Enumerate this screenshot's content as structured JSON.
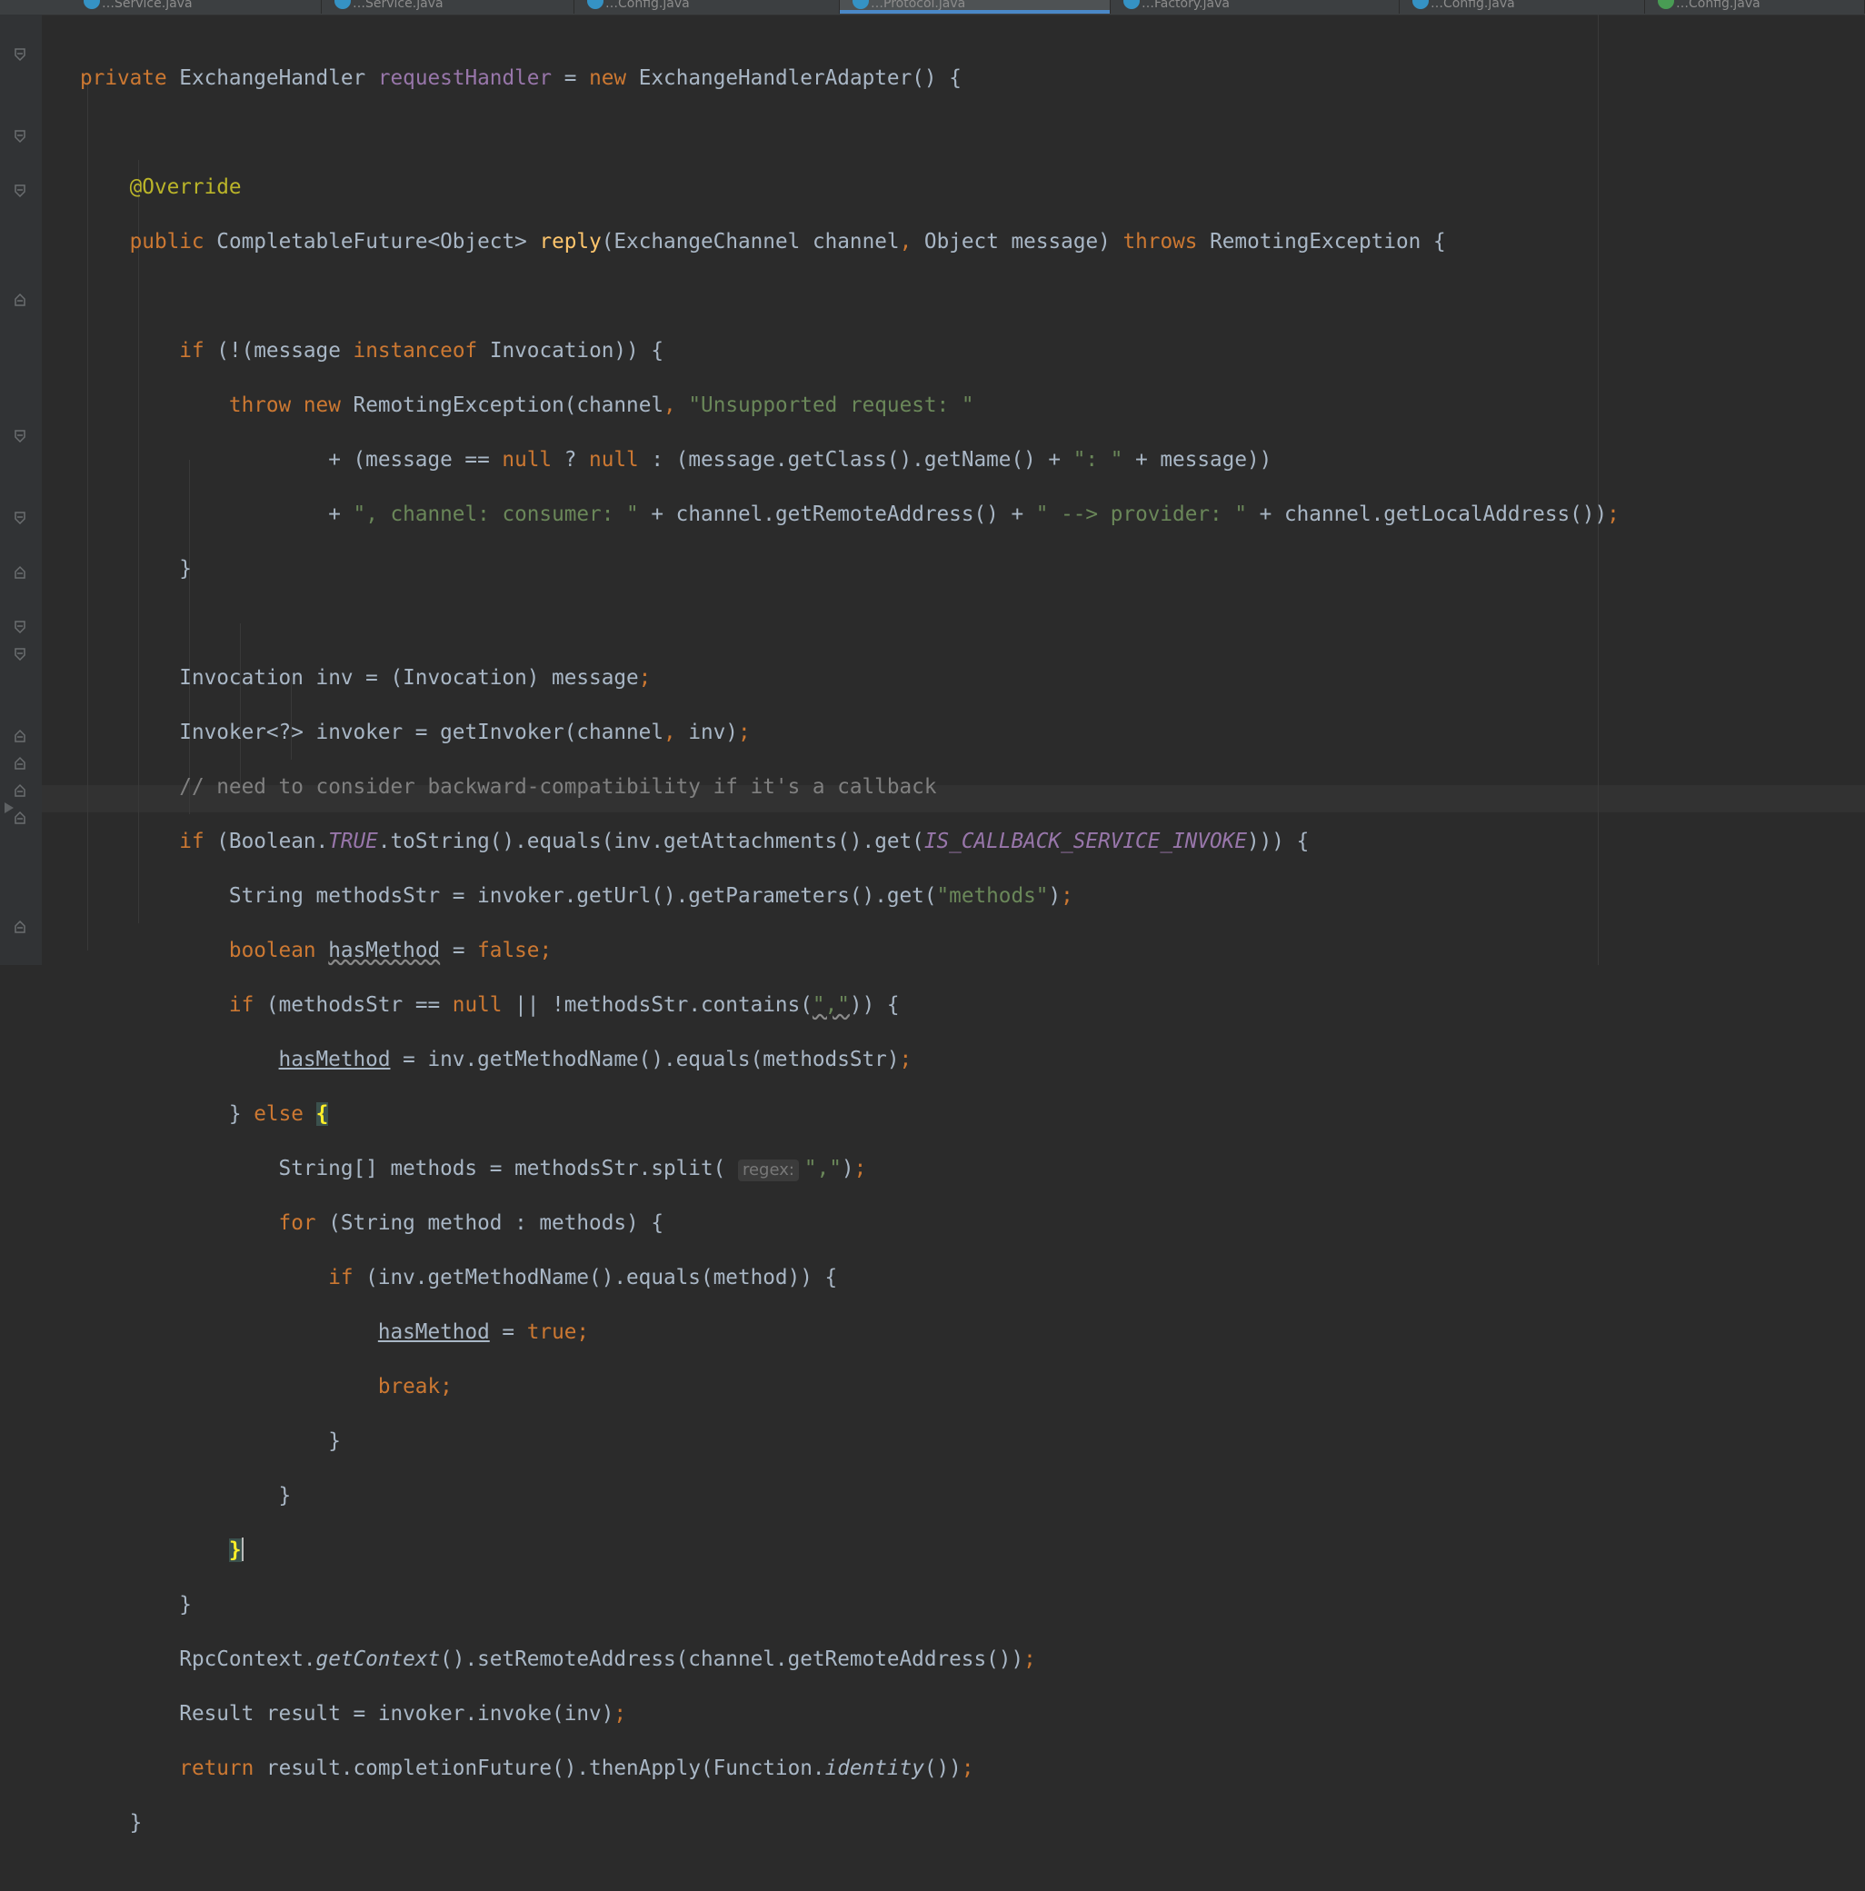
{
  "tabs": [
    {
      "label": "…Service.java",
      "active": false
    },
    {
      "label": "…Service.java",
      "active": false
    },
    {
      "label": "…Config.java",
      "active": false
    },
    {
      "label": "…Protocol.java",
      "active": true
    },
    {
      "label": "…Factory.java",
      "active": false
    },
    {
      "label": "…Config.java",
      "active": false
    },
    {
      "label": "…Config.java",
      "active": false
    }
  ],
  "editor": {
    "tokens": {
      "private": "private",
      "type_ExchangeHandler": "ExchangeHandler",
      "requestHandler": "requestHandler",
      "eq": " = ",
      "new": "new",
      "new_adapter": "ExchangeHandlerAdapter() {",
      "override": "@Override",
      "public": "public",
      "reply_ret": "CompletableFuture<Object>",
      "reply_name": "reply",
      "reply_params_1": "(ExchangeChannel channel",
      "comma": ",",
      "reply_params_2": "Object message)",
      "throws": "throws",
      "reply_exc": "RemotingException {",
      "if": "if",
      "instanceof": "instanceof",
      "l6_open": "(!(message",
      "l6_close": "Invocation)) {",
      "throw": "throw",
      "l7_ctor": "RemotingException(channel",
      "s_unsupported": "\"Unsupported request: \"",
      "l8_a": "+ (message == ",
      "null": "null",
      "l8_q": " ? ",
      "l8_b": " : (message.getClass().getName() + ",
      "s_colon": "\": \"",
      "l8_c": " + message))",
      "plus": "+",
      "s_channel_consumer": "\", channel: consumer: \"",
      "l9_a": " + channel.getRemoteAddress() + ",
      "s_provider": "\" --> provider: \"",
      "l9_b": " + channel.getLocalAddress())",
      "semi": ";",
      "rbrace": "}",
      "l12": "Invocation inv = (Invocation) message",
      "l13_a": "Invoker<?> invoker = getInvoker(channel",
      "l13_b": " inv)",
      "comment": "// need to consider backward-compatibility if it's a callback",
      "l15_a": " (Boolean.",
      "TRUE": "TRUE",
      "l15_b": ".toString().equals(inv.getAttachments().get(",
      "IS_CALLBACK": "IS_CALLBACK_SERVICE_INVOKE",
      "l15_c": "))) {",
      "l16_a": "String methodsStr = invoker.getUrl().getParameters().get(",
      "s_methods": "\"methods\"",
      "l16_b": ")",
      "boolean": "boolean",
      "hasMethod": "hasMethod",
      "false": "false",
      "true": "true",
      "l18_a": " (methodsStr == ",
      "l18_b": " || !methodsStr.contains(",
      "s_comma_q": "\",\"",
      "l18_c": ")) {",
      "l19_a": " = inv.getMethodName().equals(methodsStr)",
      "else": "else",
      "lbrace": "{",
      "l21_a": "String[] methods = methodsStr.split( ",
      "regex_hint": "regex:",
      "l21_b": ")",
      "for": "for",
      "l22": " (String method : methods) {",
      "l23": " (inv.getMethodName().equals(method)) {",
      "break": "break",
      "l28_a": "RpcContext.",
      "getContext": "getContext",
      "l28_b": "().setRemoteAddress(channel.getRemoteAddress())",
      "l29": "Result result = invoker.invoke(inv)",
      "return": "return",
      "l30_a": " result.completionFuture().thenApply(Function.",
      "identity": "identity",
      "l30_b": "())"
    }
  }
}
